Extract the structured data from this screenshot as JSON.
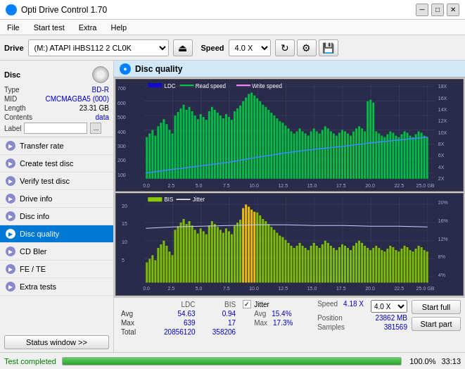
{
  "titleBar": {
    "title": "Opti Drive Control 1.70",
    "iconColor": "#0080ff"
  },
  "menuBar": {
    "items": [
      "File",
      "Start test",
      "Extra",
      "Help"
    ]
  },
  "toolbar": {
    "driveLabel": "Drive",
    "driveValue": "(M:) ATAPI iHBS112  2 CL0K",
    "speedLabel": "Speed",
    "speedValue": "4.0 X"
  },
  "disc": {
    "title": "Disc",
    "typeLabel": "Type",
    "typeValue": "BD-R",
    "midLabel": "MID",
    "midValue": "CMCMAGBA5 (000)",
    "lengthLabel": "Length",
    "lengthValue": "23.31 GB",
    "contentsLabel": "Contents",
    "contentsValue": "data",
    "labelLabel": "Label",
    "labelValue": ""
  },
  "navItems": [
    {
      "id": "transfer-rate",
      "label": "Transfer rate",
      "active": false
    },
    {
      "id": "create-test-disc",
      "label": "Create test disc",
      "active": false
    },
    {
      "id": "verify-test-disc",
      "label": "Verify test disc",
      "active": false
    },
    {
      "id": "drive-info",
      "label": "Drive info",
      "active": false
    },
    {
      "id": "disc-info",
      "label": "Disc info",
      "active": false
    },
    {
      "id": "disc-quality",
      "label": "Disc quality",
      "active": true
    },
    {
      "id": "cd-bler",
      "label": "CD Bler",
      "active": false
    },
    {
      "id": "fe-te",
      "label": "FE / TE",
      "active": false
    },
    {
      "id": "extra-tests",
      "label": "Extra tests",
      "active": false
    }
  ],
  "statusWindowBtn": "Status window >>",
  "discQuality": {
    "title": "Disc quality",
    "legend": {
      "ldc": "LDC",
      "readSpeed": "Read speed",
      "writeSpeed": "Write speed",
      "bis": "BIS",
      "jitter": "Jitter"
    },
    "chart1": {
      "yAxisLabel": "",
      "yRight": [
        "18X",
        "16X",
        "14X",
        "12X",
        "10X",
        "8X",
        "6X",
        "4X",
        "2X"
      ],
      "yLeft": [
        700,
        600,
        500,
        400,
        300,
        200,
        100
      ],
      "xAxis": [
        "0.0",
        "2.5",
        "5.0",
        "7.5",
        "10.0",
        "12.5",
        "15.0",
        "17.5",
        "20.0",
        "22.5",
        "25.0 GB"
      ]
    },
    "chart2": {
      "yLeft": [
        20,
        15,
        10,
        5
      ],
      "yRight": [
        "20%",
        "16%",
        "12%",
        "8%",
        "4%"
      ],
      "xAxis": [
        "0.0",
        "2.5",
        "5.0",
        "7.5",
        "10.0",
        "12.5",
        "15.0",
        "17.5",
        "20.0",
        "22.5",
        "25.0 GB"
      ]
    }
  },
  "stats": {
    "headers": [
      "LDC",
      "BIS"
    ],
    "rows": [
      {
        "label": "Avg",
        "ldc": "54.63",
        "bis": "0.94"
      },
      {
        "label": "Max",
        "ldc": "639",
        "bis": "17"
      },
      {
        "label": "Total",
        "ldc": "20856120",
        "bis": "358206"
      }
    ],
    "jitter": {
      "checked": true,
      "label": "Jitter",
      "avg": "15.4%",
      "max": "17.3%"
    },
    "speed": {
      "label": "Speed",
      "value": "4.18 X",
      "speedSelectValue": "4.0 X"
    },
    "position": {
      "label": "Position",
      "value": "23862 MB"
    },
    "samples": {
      "label": "Samples",
      "value": "381569"
    },
    "buttons": {
      "startFull": "Start full",
      "startPart": "Start part"
    }
  },
  "statusBar": {
    "text": "Test completed",
    "progressPercent": 100,
    "progressLabel": "100.0%",
    "time": "33:13"
  }
}
